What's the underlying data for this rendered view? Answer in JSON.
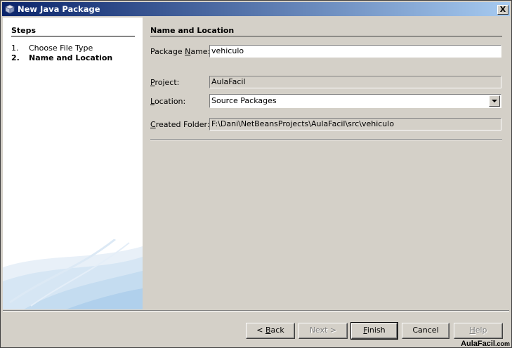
{
  "window": {
    "title": "New Java Package",
    "close_glyph": "X"
  },
  "steps": {
    "title": "Steps",
    "items": [
      {
        "num": "1.",
        "label": "Choose File Type"
      },
      {
        "num": "2.",
        "label": "Name and Location"
      }
    ]
  },
  "form": {
    "section_title": "Name and Location",
    "package_name": {
      "label_pre": "Package ",
      "label_key": "N",
      "label_post": "ame:",
      "value": "vehiculo"
    },
    "project": {
      "label_key": "P",
      "label_post": "roject:",
      "value": "AulaFacil"
    },
    "location": {
      "label_key": "L",
      "label_post": "ocation:",
      "value": "Source Packages"
    },
    "created_folder": {
      "label_key": "C",
      "label_post": "reated Folder:",
      "value": "F:\\Dani\\NetBeansProjects\\AulaFacil\\src\\vehiculo"
    }
  },
  "buttons": {
    "back": {
      "pre": "< ",
      "key": "B",
      "post": "ack"
    },
    "next": "Next >",
    "finish": {
      "key": "F",
      "post": "inish"
    },
    "cancel": "Cancel",
    "help": {
      "key": "H",
      "post": "elp"
    }
  },
  "watermark": {
    "main": "AulaFacil",
    "suffix": ".com"
  }
}
